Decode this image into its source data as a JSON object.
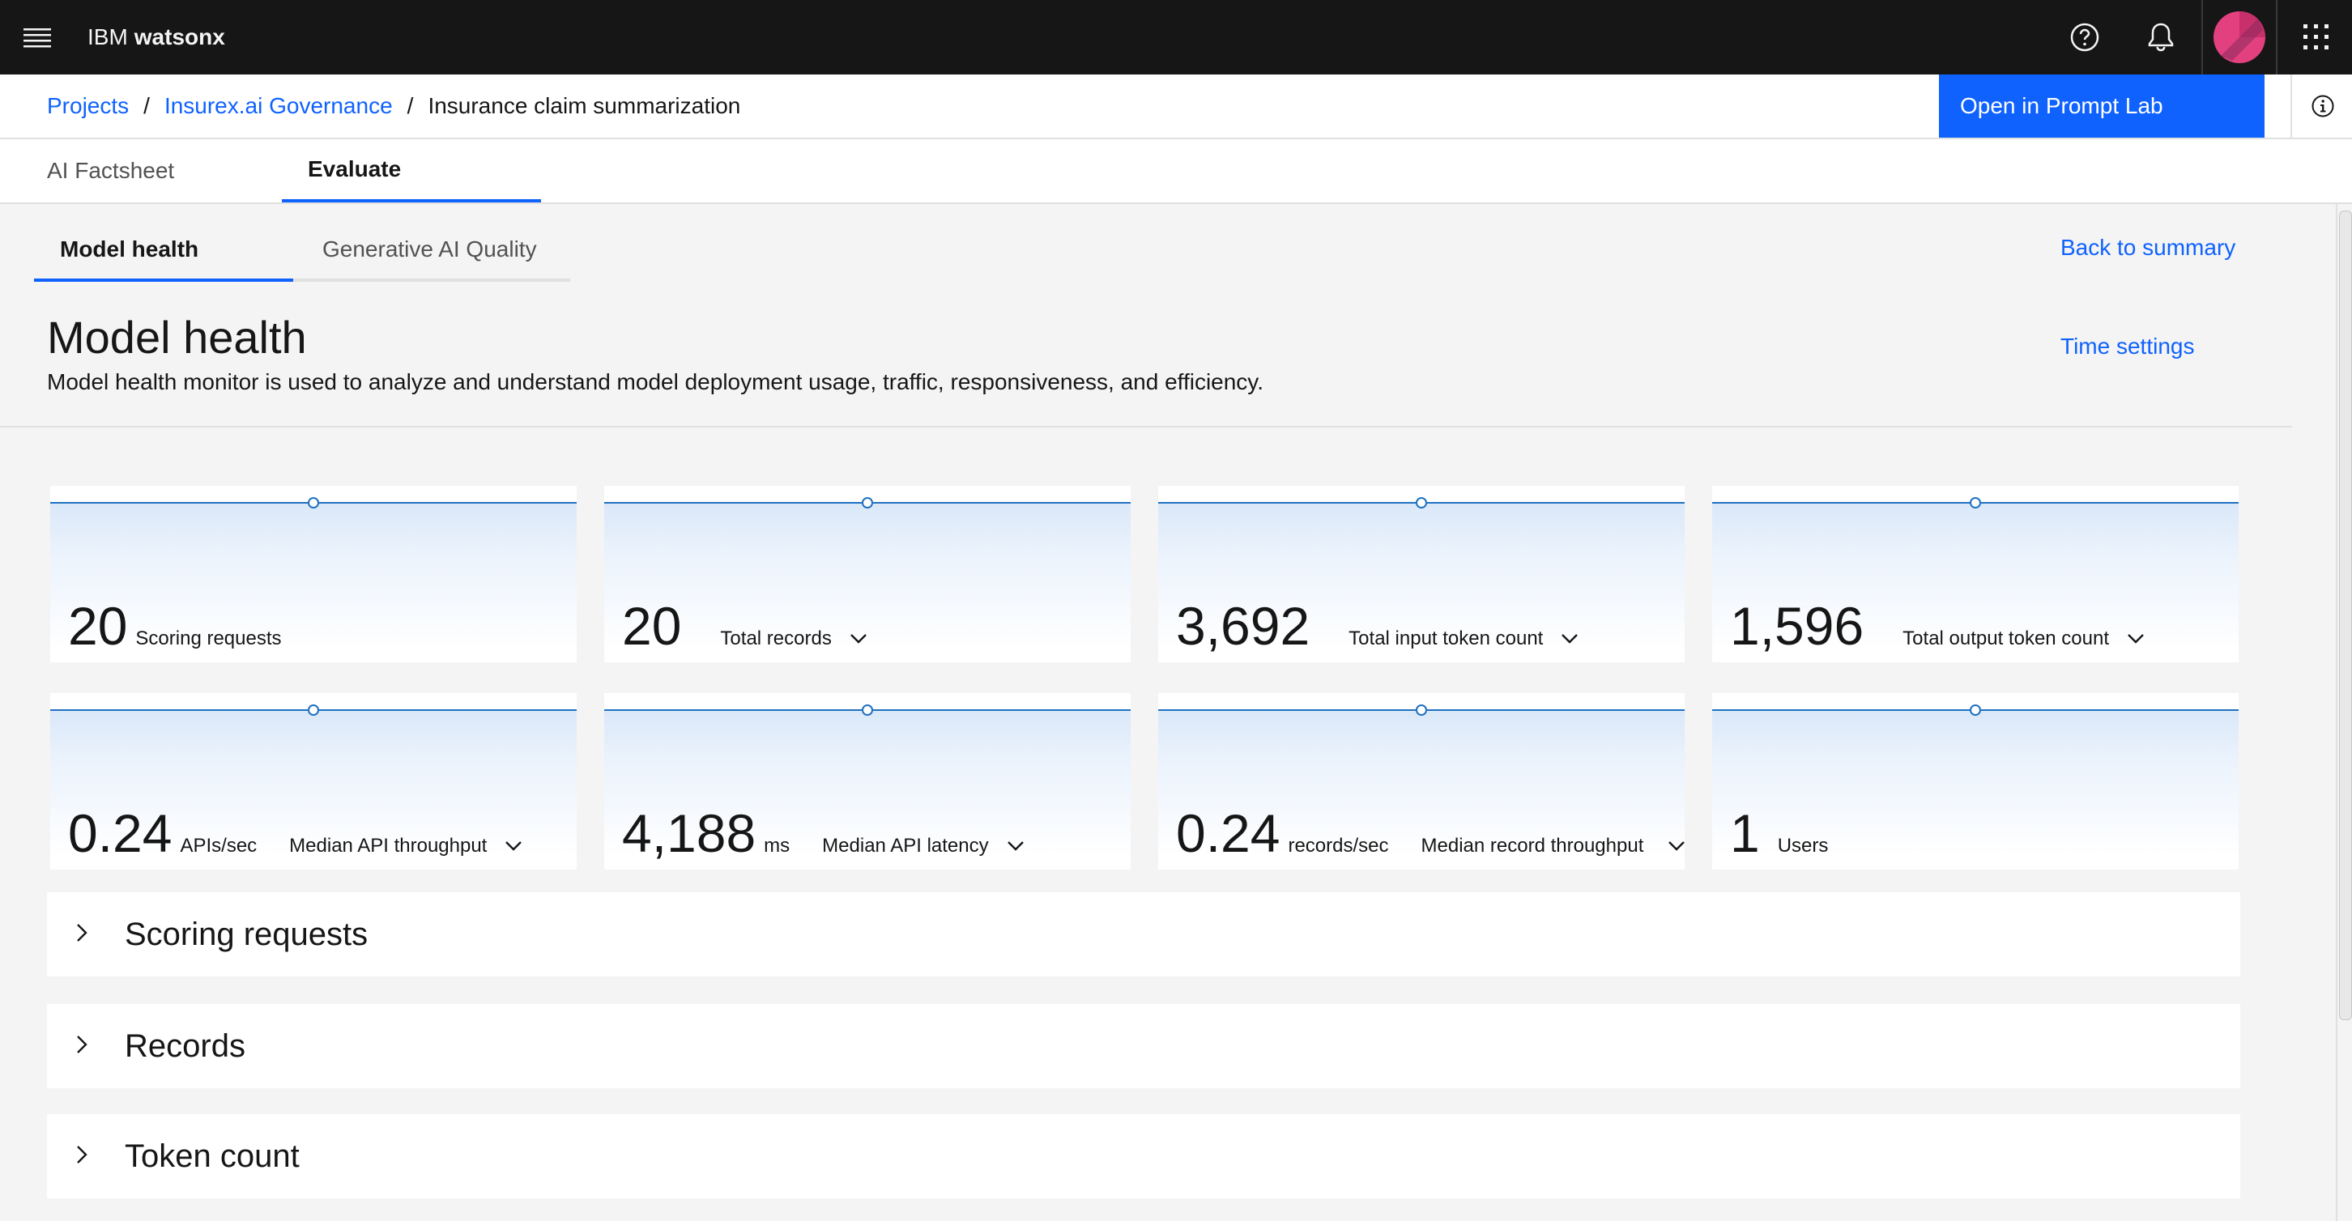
{
  "header": {
    "brand_prefix": "IBM",
    "brand_name": "watsonx",
    "icons": [
      "menu-icon",
      "help-icon",
      "notification-icon",
      "avatar",
      "app-switcher-icon"
    ]
  },
  "breadcrumb": {
    "items": [
      "Projects",
      "Insurex.ai Governance",
      "Insurance claim summarization"
    ],
    "separator": "/"
  },
  "actions": {
    "open_prompt_lab": "Open in Prompt Lab"
  },
  "main_tabs": [
    {
      "label": "AI Factsheet",
      "active": false
    },
    {
      "label": "Evaluate",
      "active": true
    }
  ],
  "sub_tabs": [
    {
      "label": "Model health",
      "active": true
    },
    {
      "label": "Generative AI Quality",
      "active": false
    }
  ],
  "links": {
    "back_to_summary": "Back to summary",
    "time_settings": "Time settings"
  },
  "page": {
    "title": "Model health",
    "description": "Model health monitor is used to analyze and understand model deployment usage, traffic, responsiveness, and efficiency."
  },
  "metrics": [
    {
      "value": "20",
      "unit": "",
      "label": "Scoring requests",
      "dropdown": false
    },
    {
      "value": "20",
      "unit": "",
      "label": "Total records",
      "dropdown": true
    },
    {
      "value": "3,692",
      "unit": "",
      "label": "Total input token count",
      "dropdown": true
    },
    {
      "value": "1,596",
      "unit": "",
      "label": "Total output token count",
      "dropdown": true
    },
    {
      "value": "0.24",
      "unit": "APIs/sec",
      "label": "Median API throughput",
      "dropdown": true
    },
    {
      "value": "4,188",
      "unit": "ms",
      "label": "Median API latency",
      "dropdown": true
    },
    {
      "value": "0.24",
      "unit": "records/sec",
      "label": "Median record throughput",
      "dropdown": true
    },
    {
      "value": "1",
      "unit": "",
      "label": "Users",
      "dropdown": false
    }
  ],
  "sections": [
    {
      "title": "Scoring requests",
      "expanded": false
    },
    {
      "title": "Records",
      "expanded": false
    },
    {
      "title": "Token count",
      "expanded": false
    }
  ],
  "colors": {
    "primary": "#0f62fe",
    "header_bg": "#161616",
    "page_bg": "#f4f4f4",
    "sparkline": "#1f70c1"
  }
}
